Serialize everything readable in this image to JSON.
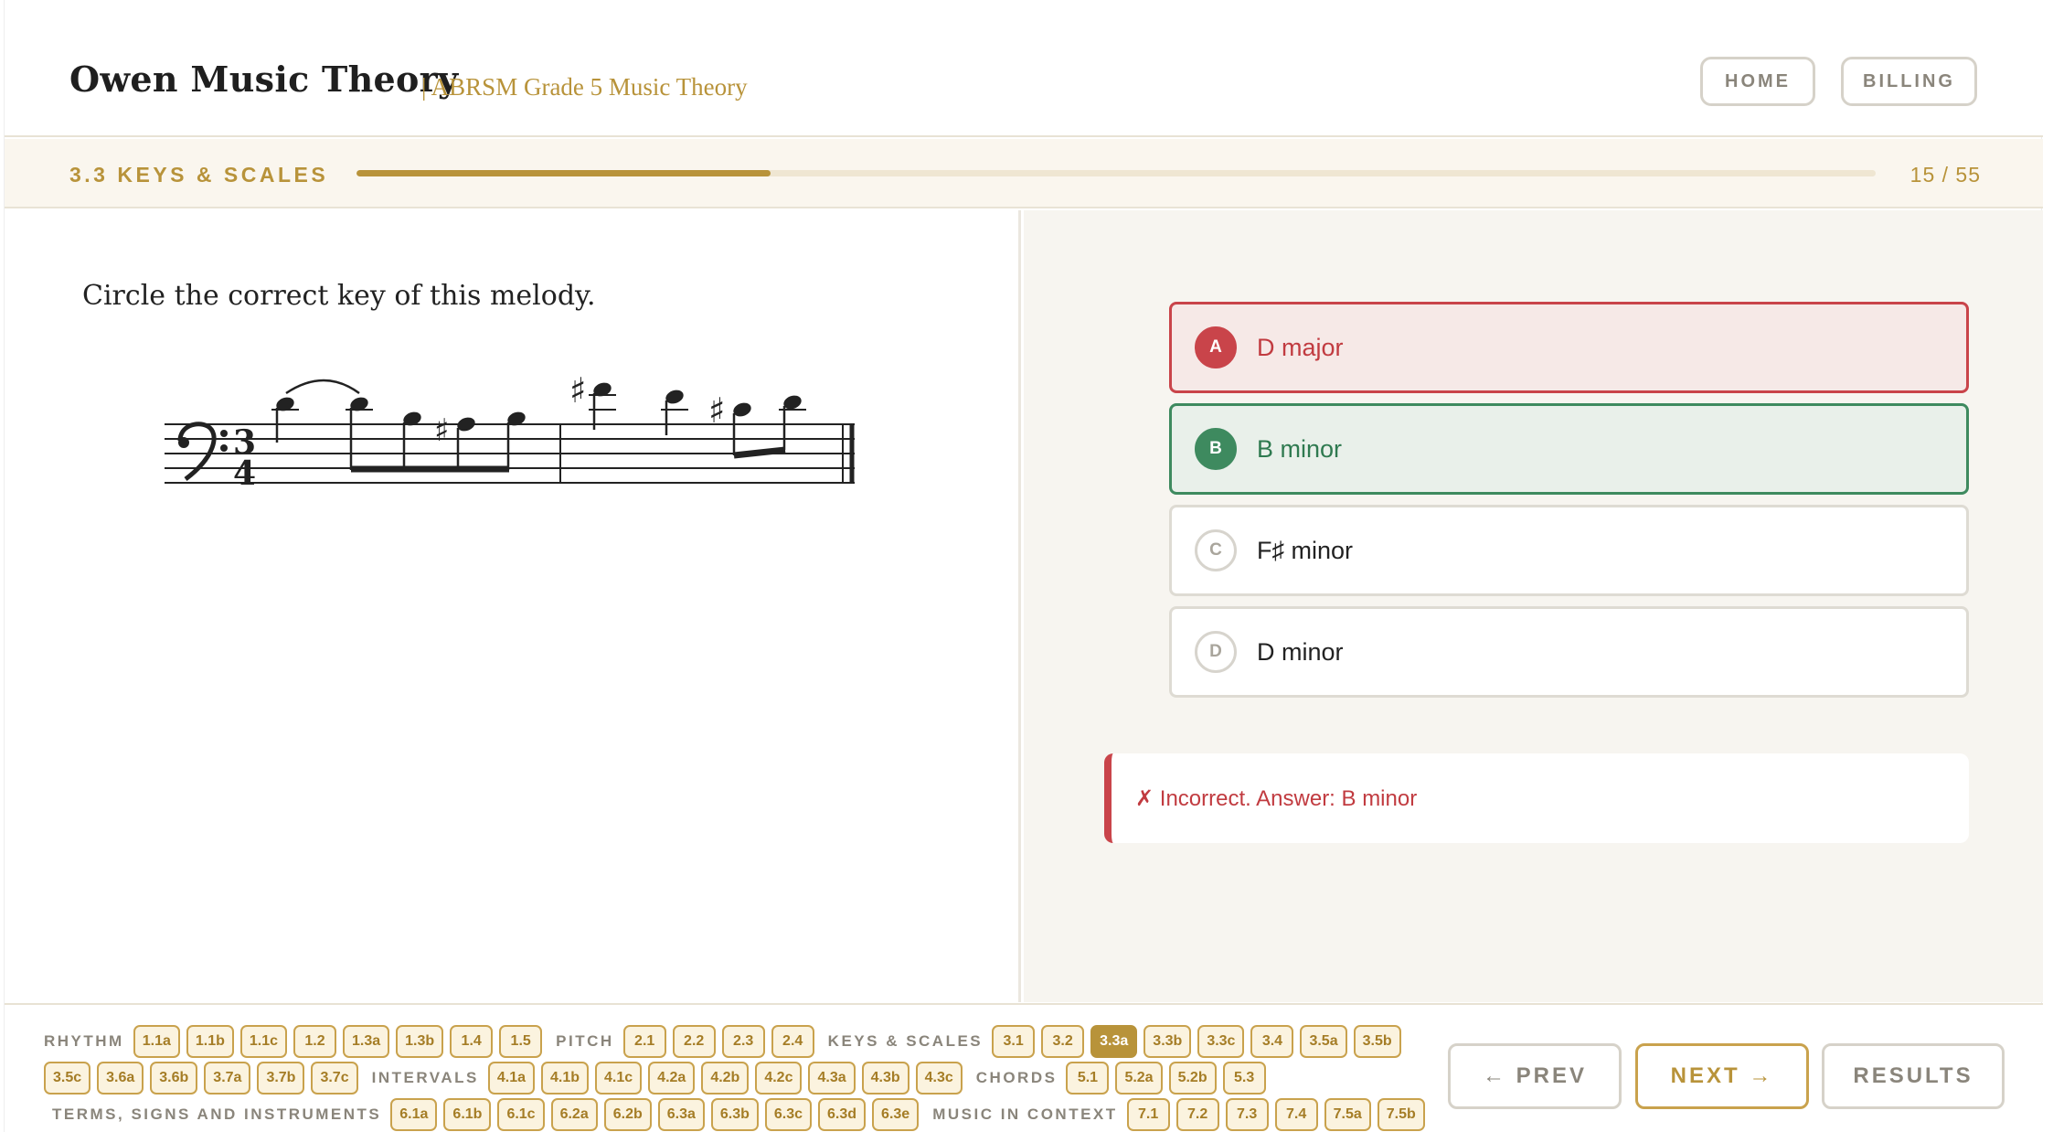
{
  "header": {
    "brand": "Owen Music Theory",
    "subtitle": "| ABRSM Grade 5 Music Theory",
    "home_label": "HOME",
    "billing_label": "BILLING"
  },
  "progress": {
    "section": "3.3 KEYS & SCALES",
    "count": "15 / 55",
    "fraction": 0.2727
  },
  "question": {
    "prompt": "Circle the correct key of this melody."
  },
  "options": [
    {
      "letter": "A",
      "label": "D major",
      "state": "wrong"
    },
    {
      "letter": "B",
      "label": "B minor",
      "state": "right"
    },
    {
      "letter": "C",
      "label": "F♯ minor",
      "state": "none"
    },
    {
      "letter": "D",
      "label": "D minor",
      "state": "none"
    }
  ],
  "feedback": {
    "text": "✗ Incorrect. Answer: B minor"
  },
  "nav": {
    "rows": [
      [
        {
          "cat": "RHYTHM"
        },
        {
          "chip": "1.1a"
        },
        {
          "chip": "1.1b"
        },
        {
          "chip": "1.1c"
        },
        {
          "chip": "1.2"
        },
        {
          "chip": "1.3a"
        },
        {
          "chip": "1.3b"
        },
        {
          "chip": "1.4"
        },
        {
          "chip": "1.5"
        },
        {
          "cat": "PITCH"
        },
        {
          "chip": "2.1"
        },
        {
          "chip": "2.2"
        },
        {
          "chip": "2.3"
        },
        {
          "chip": "2.4"
        },
        {
          "cat": "KEYS & SCALES"
        },
        {
          "chip": "3.1"
        },
        {
          "chip": "3.2"
        },
        {
          "chip": "3.3a",
          "active": true
        },
        {
          "chip": "3.3b"
        },
        {
          "chip": "3.3c"
        },
        {
          "chip": "3.4"
        },
        {
          "chip": "3.5a"
        },
        {
          "chip": "3.5b"
        }
      ],
      [
        {
          "chip": "3.5c"
        },
        {
          "chip": "3.6a"
        },
        {
          "chip": "3.6b"
        },
        {
          "chip": "3.7a"
        },
        {
          "chip": "3.7b"
        },
        {
          "chip": "3.7c"
        },
        {
          "cat": "INTERVALS"
        },
        {
          "chip": "4.1a"
        },
        {
          "chip": "4.1b"
        },
        {
          "chip": "4.1c"
        },
        {
          "chip": "4.2a"
        },
        {
          "chip": "4.2b"
        },
        {
          "chip": "4.2c"
        },
        {
          "chip": "4.3a"
        },
        {
          "chip": "4.3b"
        },
        {
          "chip": "4.3c"
        },
        {
          "cat": "CHORDS"
        },
        {
          "chip": "5.1"
        },
        {
          "chip": "5.2a"
        },
        {
          "chip": "5.2b"
        },
        {
          "chip": "5.3"
        }
      ],
      [
        {
          "cat": "TERMS, SIGNS AND INSTRUMENTS"
        },
        {
          "chip": "6.1a"
        },
        {
          "chip": "6.1b"
        },
        {
          "chip": "6.1c"
        },
        {
          "chip": "6.2a"
        },
        {
          "chip": "6.2b"
        },
        {
          "chip": "6.3a"
        },
        {
          "chip": "6.3b"
        },
        {
          "chip": "6.3c"
        },
        {
          "chip": "6.3d"
        },
        {
          "chip": "6.3e"
        },
        {
          "cat": "MUSIC IN CONTEXT"
        },
        {
          "chip": "7.1"
        },
        {
          "chip": "7.2"
        },
        {
          "chip": "7.3"
        },
        {
          "chip": "7.4"
        },
        {
          "chip": "7.5a"
        },
        {
          "chip": "7.5b"
        }
      ]
    ],
    "prev_label": "← PREV",
    "next_label": "NEXT →",
    "results_label": "RESULTS"
  },
  "icons": {
    "clef": "bass-clef-icon",
    "sharp": "sharp-icon"
  },
  "colors": {
    "accent": "#b8933a",
    "wrong": "#c9444a",
    "right": "#3e8a5f"
  }
}
